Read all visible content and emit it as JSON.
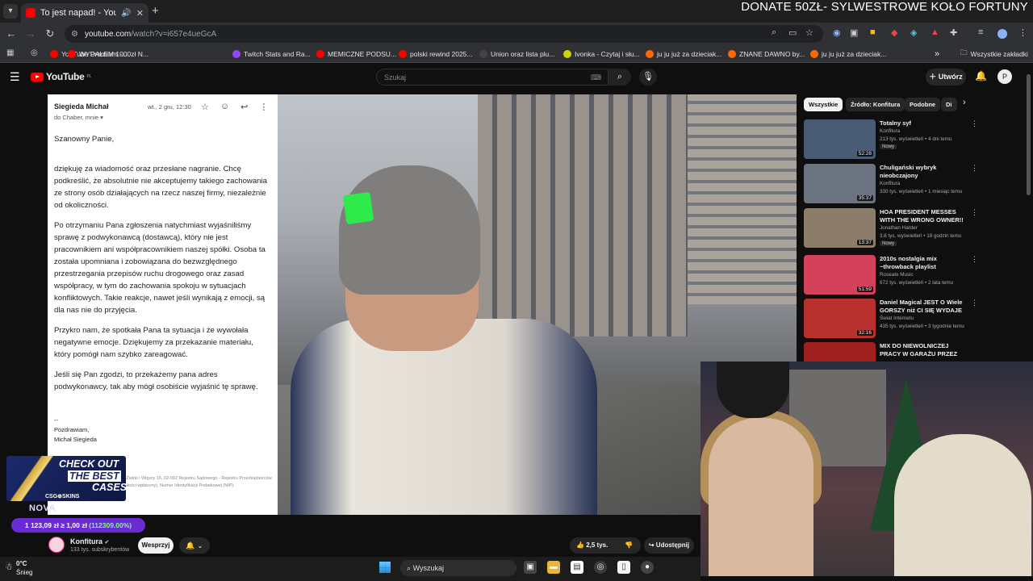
{
  "browser": {
    "tab_title": "To jest napad! - YouTube",
    "url_host": "youtube.com",
    "url_path": "/watch?v=i657e4ueGcA",
    "overlay_banner": "DONATE 50ZŁ- SYLWESTROWE KOŁO FORTUNY",
    "bookmarks": [
      {
        "label": "YouTube Premium -...",
        "color": "#ff0000"
      },
      {
        "label": "WYDAŁEM 1000zł N...",
        "color": "#ff0000"
      },
      {
        "label": "Twitch Stats and Ra...",
        "color": "#9146ff"
      },
      {
        "label": "MEMICZNE PODSU...",
        "color": "#ff0000"
      },
      {
        "label": "polski rewind 2025...",
        "color": "#ff0000"
      },
      {
        "label": "Union oraz lista plu...",
        "color": "#444444"
      },
      {
        "label": "Ivonka - Czytaj i słu...",
        "color": "#c9d400"
      },
      {
        "label": "ju ju już za dzieciak...",
        "color": "#ff6a00"
      },
      {
        "label": "ZNANE DAWNO by...",
        "color": "#ff6a00"
      },
      {
        "label": "ju ju już za dzieciak...",
        "color": "#ff6a00"
      }
    ],
    "all_bookmarks": "Wszystkie zakładki"
  },
  "youtube": {
    "logo": "YouTube",
    "logo_sup": "PL",
    "search_placeholder": "Szukaj",
    "create_label": "Utwórz",
    "avatar_letter": "P"
  },
  "email": {
    "sender": "Siegieda Michał",
    "date": "wt., 2 gru, 12:30",
    "to": "do Chaber, mnie",
    "greeting": "Szanowny Panie,",
    "p1": "dziękuję za wiadomość oraz przesłane nagranie. Chcę podkreślić, że absolutnie nie akceptujemy takiego zachowania ze strony osób działających na rzecz naszej firmy, niezależnie od okoliczności.",
    "p2": "Po otrzymaniu Pana zgłoszenia natychmiast wyjaśniliśmy sprawę z podwykonawcą (dostawcą), który nie jest pracownikiem ani współpracownikiem naszej spółki. Osoba ta została upomniana i zobowiązana do bezwzględnego przestrzegania przepisów ruchu drogowego oraz zasad współpracy, w tym do zachowania spokoju w sytuacjach konfliktowych. Takie reakcje, nawet jeśli wynikają z emocji, są dla nas nie do przyjęcia.",
    "p3": "Przykro nam, że spotkała Pana ta sytuacja i że wywołała negatywne emocje. Dziękujemy za przekazanie materiału, który pomógł nam szybko zareagować.",
    "p4": "Jeśli się Pan zgodzi, to przekażemy pana adres podwykonawcy, tak aby mógł osobiście wyjaśnić tę sprawę.",
    "sig_sep": "--",
    "sign_off": "Pozdrawiam,",
    "sign_name": "Michał Siegieda",
    "footer": "Akcyjna z siedzibą w Warszawie, ul. Żwirki i Wigury 16, 02-092 Rejestru Sądowego - Rejestru Przedsiębiorców kapitał zakładowy: 1 461 600 zł (w całości wpłacony), Numer Identyfikacji Podatkowej (NIP):"
  },
  "promo": {
    "line1": "CHECK OUT",
    "line2": "THE BEST",
    "line3": "CASES",
    "brand": "CSG⊕SKINS",
    "nova": "NOVA",
    "price": "1 123,09 zł ≥ 1,00 zł",
    "price_pct": "(112309.00%)"
  },
  "channel": {
    "name": "Konfitura",
    "subs": "133 tys. subskrybentów",
    "support_label": "Wesprzyj",
    "likes": "2,5 tys.",
    "share_label": "Udostępnij"
  },
  "chips": [
    "Wszystkie",
    "Źródło: Konfitura",
    "Podobne",
    "Di"
  ],
  "recommendations": [
    {
      "title": "Totalny syf",
      "channel": "Konfitura",
      "meta": "213 tys. wyświetleń • 4 dni temu",
      "badge": "Nowy",
      "duration": "52:28",
      "thumb": "#4a5c74"
    },
    {
      "title": "Chuligański wybryk nieobczajony",
      "channel": "Konfitura",
      "meta": "330 tys. wyświetleń • 1 miesiąc temu",
      "badge": "",
      "duration": "35:37",
      "thumb": "#6b7380"
    },
    {
      "title": "HOA PRESIDENT MESSES WITH THE WRONG OWNER!! (Full ...",
      "channel": "Jonathan Harder",
      "meta": "3,6 tys. wyświetleń • 18 godzin temu",
      "badge": "Nowy",
      "duration": "13:37",
      "thumb": "#8b7d6a"
    },
    {
      "title": "2010s nostalgia mix ~throwback playlist",
      "channel": "Roseate Music",
      "meta": "672 tys. wyświetleń • 2 lata temu",
      "badge": "",
      "duration": "51:59",
      "thumb": "#d4415a"
    },
    {
      "title": "Daniel Magical JEST O Wiele GORSZY niż CI SIĘ WYDAJE",
      "channel": "Świat Internetu",
      "meta": "435 tys. wyświetleń • 3 tygodnie temu",
      "badge": "",
      "duration": "32:16",
      "thumb": "#b8312f"
    },
    {
      "title": "MIX DO NIEWOLNICZEJ PRACY W GARAŻU PRZEZ 12H ZA ...",
      "channel": "",
      "meta": "",
      "badge": "",
      "duration": "",
      "thumb": "#a02020"
    }
  ],
  "taskbar": {
    "temp": "0°C",
    "weather": "Śnieg",
    "search": "Wyszukaj"
  }
}
